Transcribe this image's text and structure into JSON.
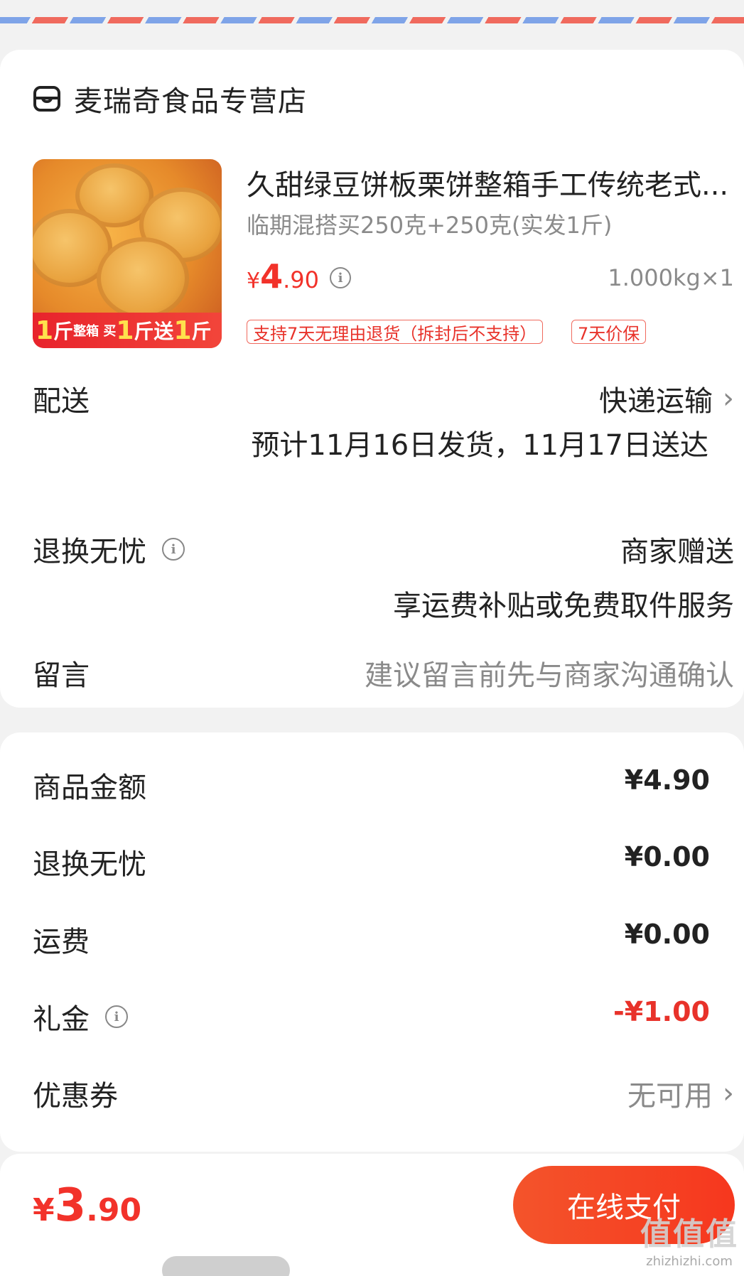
{
  "shop": {
    "name": "麦瑞奇食品专营店",
    "icon": "store-icon"
  },
  "product": {
    "title": "久甜绿豆饼板栗饼整箱手工传统老式...",
    "spec": "临期混搭买250克+250克(实发1斤)",
    "price": {
      "currency": "¥",
      "integer": "4",
      "decimal": ".90"
    },
    "quantity": "1.000kg×1",
    "image_banner": {
      "part1": "1",
      "part2": "斤",
      "part3": "整箱 买",
      "part4": "1",
      "part5": "斤送",
      "part6": "1",
      "part7": "斤"
    },
    "tags": [
      "支持7天无理由退货（拆封后不支持）",
      "7天价保"
    ]
  },
  "delivery": {
    "label": "配送",
    "method": "快递运输",
    "estimate": "预计11月16日发货，11月17日送达"
  },
  "returns": {
    "label": "退换无忧",
    "value": "商家赠送",
    "desc": "享运费补贴或免费取件服务"
  },
  "message": {
    "label": "留言",
    "placeholder": "建议留言前先与商家沟通确认"
  },
  "summary": [
    {
      "label": "商品金额",
      "value": "¥4.90"
    },
    {
      "label": "退换无忧",
      "value": "¥0.00"
    },
    {
      "label": "运费",
      "value": "¥0.00"
    },
    {
      "label": "礼金",
      "value": "-¥1.00"
    },
    {
      "label": "优惠券",
      "value": "无可用"
    }
  ],
  "footer": {
    "total": {
      "currency": "¥",
      "integer": "3",
      "decimal": ".90"
    },
    "pay_label": "在线支付"
  },
  "watermark": {
    "big": "值值值",
    "small": "zhizhizhi.com"
  },
  "colors": {
    "accent": "#f2322a",
    "pay_button": "#f6371e"
  }
}
